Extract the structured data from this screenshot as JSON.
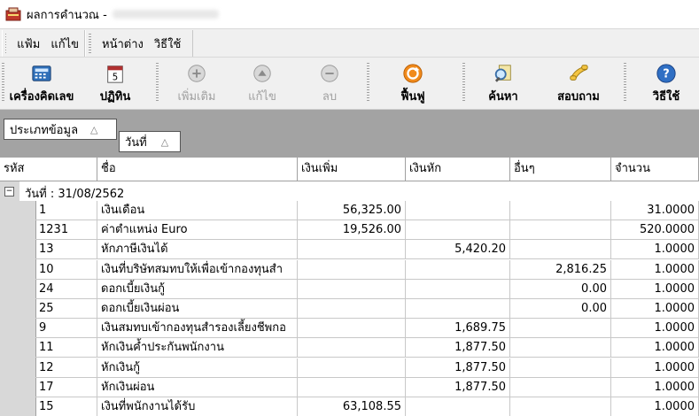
{
  "window": {
    "title": "ผลการคำนวณ -"
  },
  "menu": {
    "items": [
      "แฟ้ม",
      "แก้ไข",
      "หน้าต่าง",
      "วิธีใช้"
    ]
  },
  "toolbar": {
    "calculator": "เครื่องคิดเลข",
    "calendar": "ปฏิทิน",
    "calendar_day": "5",
    "add": "เพิ่มเติม",
    "edit": "แก้ไข",
    "delete": "ลบ",
    "restore": "ฟื้นฟู",
    "search": "ค้นหา",
    "inquiry": "สอบถาม",
    "help": "วิธีใช้"
  },
  "grouping": {
    "chip1": "ประเภทข้อมูล",
    "chip2": "วันที่",
    "sort_glyph": "△"
  },
  "columns": [
    "รหัส",
    "ชื่อ",
    "เงินเพิ่ม",
    "เงินหัก",
    "อื่นๆ",
    "จำนวน"
  ],
  "group_label": "วันที่ : 31/08/2562",
  "rows": [
    {
      "code": "1",
      "name": "เงินเดือน",
      "add": "56,325.00",
      "deduct": "",
      "other": "",
      "qty": "31.0000"
    },
    {
      "code": "1231",
      "name": "ค่าตำแหน่ง Euro",
      "add": "19,526.00",
      "deduct": "",
      "other": "",
      "qty": "520.0000"
    },
    {
      "code": "13",
      "name": "หักภาษีเงินได้",
      "add": "",
      "deduct": "5,420.20",
      "other": "",
      "qty": "1.0000"
    },
    {
      "code": "10",
      "name": "เงินที่บริษัทสมทบให้เพื่อเข้ากองทุนสำ",
      "add": "",
      "deduct": "",
      "other": "2,816.25",
      "qty": "1.0000"
    },
    {
      "code": "24",
      "name": "ดอกเบี้ยเงินกู้",
      "add": "",
      "deduct": "",
      "other": "0.00",
      "qty": "1.0000"
    },
    {
      "code": "25",
      "name": "ดอกเบี้ยเงินผ่อน",
      "add": "",
      "deduct": "",
      "other": "0.00",
      "qty": "1.0000"
    },
    {
      "code": "9",
      "name": "เงินสมทบเข้ากองทุนสำรองเลี้ยงชีพกอ",
      "add": "",
      "deduct": "1,689.75",
      "other": "",
      "qty": "1.0000"
    },
    {
      "code": "11",
      "name": "หักเงินค้ำประกันพนักงาน",
      "add": "",
      "deduct": "1,877.50",
      "other": "",
      "qty": "1.0000"
    },
    {
      "code": "12",
      "name": "หักเงินกู้",
      "add": "",
      "deduct": "1,877.50",
      "other": "",
      "qty": "1.0000"
    },
    {
      "code": "17",
      "name": "หักเงินผ่อน",
      "add": "",
      "deduct": "1,877.50",
      "other": "",
      "qty": "1.0000"
    },
    {
      "code": "15",
      "name": "เงินที่พนักงานได้รับ",
      "add": "63,108.55",
      "deduct": "",
      "other": "",
      "qty": "1.0000"
    }
  ]
}
